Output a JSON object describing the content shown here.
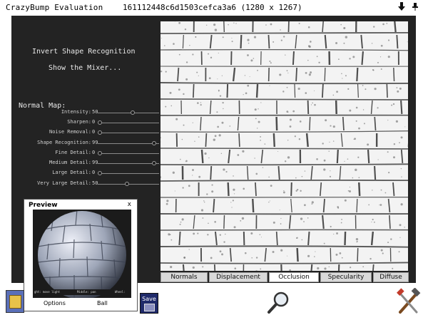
{
  "window": {
    "app_title": "CrazyBump Evaluation",
    "file_title": "161112448c6d1503cefca3a6 (1280 x 1267)",
    "icons": [
      "download-icon",
      "pin-icon"
    ]
  },
  "menu": {
    "invert": "Invert Shape Recognition",
    "mixer": "Show the Mixer..."
  },
  "normal_map": {
    "title": "Normal Map:",
    "sliders": [
      {
        "label": "Intensity:",
        "value": "50",
        "level": 0.58
      },
      {
        "label": "Sharpen:",
        "value": "0",
        "level": 0.0
      },
      {
        "label": "Noise Removal:",
        "value": "0",
        "level": 0.0
      },
      {
        "label": "Shape Recognition:",
        "value": "99",
        "level": 0.95
      },
      {
        "label": "Fine Detail:",
        "value": "0",
        "level": 0.0
      },
      {
        "label": "Medium Detail:",
        "value": "99",
        "level": 0.95
      },
      {
        "label": "Large Detail:",
        "value": "0",
        "level": 0.0
      },
      {
        "label": "Very Large Detail:",
        "value": "50",
        "level": 0.48
      }
    ]
  },
  "tabs": [
    {
      "label": "Normals",
      "active": false
    },
    {
      "label": "Displacement",
      "active": false
    },
    {
      "label": "Occlusion",
      "active": true
    },
    {
      "label": "Specularity",
      "active": false
    },
    {
      "label": "Diffuse",
      "active": false
    }
  ],
  "preview": {
    "title": "Preview",
    "close": "x",
    "hints": [
      "ght: move light",
      "Middle: pan",
      "Wheel:"
    ],
    "options_label": "Options",
    "ball_label": "Ball"
  },
  "dock": {
    "save_label": "Save",
    "icons": [
      "file-open-icon",
      "magnifier-icon",
      "tools-icon"
    ]
  },
  "colors": {
    "panel_bg": "#232323",
    "viewport_bg": "#f3f3f3",
    "tab_active": "#ffffff",
    "tab_inactive": "#d9d9d9"
  }
}
